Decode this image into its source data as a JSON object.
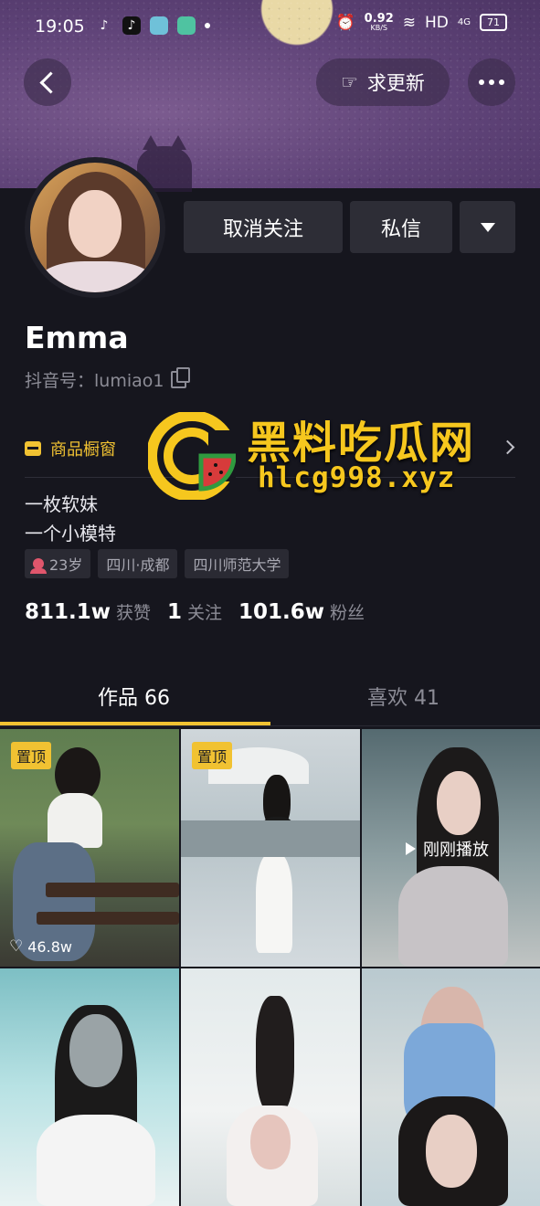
{
  "status_bar": {
    "time": "19:05",
    "network_speed_value": "0.92",
    "network_speed_unit": "KB/S",
    "hd_label": "HD",
    "signal_label": "4G",
    "battery": "71"
  },
  "top_nav": {
    "update_label": "求更新"
  },
  "profile": {
    "unfollow_label": "取消关注",
    "message_label": "私信",
    "name": "Emma",
    "douyin_id": "抖音号：lumiao1",
    "shop_label": "商品橱窗",
    "bio_lines": [
      "一枚软妹",
      "一个小模特"
    ],
    "tags": [
      "23岁",
      "四川·成都",
      "四川师范大学"
    ],
    "stats": [
      {
        "value": "811.1w",
        "label": "获赞"
      },
      {
        "value": "1",
        "label": "关注"
      },
      {
        "value": "101.6w",
        "label": "粉丝"
      }
    ]
  },
  "tabs": {
    "works": "作品 66",
    "likes": "喜欢 41"
  },
  "grid": {
    "pinned_label": "置顶",
    "first_likes": "46.8w",
    "just_played": "刚刚播放"
  },
  "watermark": {
    "title": "黑料吃瓜网",
    "url": "hlcg998.xyz"
  },
  "colors": {
    "accent": "#f1c232",
    "background": "#16161e",
    "button": "#2d2d36"
  }
}
